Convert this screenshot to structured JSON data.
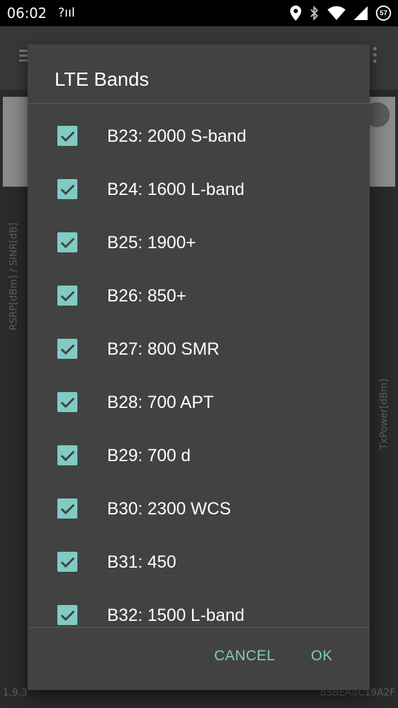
{
  "status_bar": {
    "time": "06:02",
    "signal_text": "?ııl",
    "battery": "57"
  },
  "background_app": {
    "chart_left_label": "RSRP[dBm] / SINR[dB]",
    "chart_right_label": "TxPower[dBm]",
    "bottom_left": "1,9,3",
    "bottom_right": "8SBEA8C19A2F"
  },
  "dialog": {
    "title": "LTE Bands",
    "items": [
      {
        "label": "B23: 2000 S-band",
        "checked": true
      },
      {
        "label": "B24: 1600 L-band",
        "checked": true
      },
      {
        "label": "B25: 1900+",
        "checked": true
      },
      {
        "label": "B26: 850+",
        "checked": true
      },
      {
        "label": "B27: 800 SMR",
        "checked": true
      },
      {
        "label": "B28: 700 APT",
        "checked": true
      },
      {
        "label": "B29: 700 d",
        "checked": true
      },
      {
        "label": "B30: 2300 WCS",
        "checked": true
      },
      {
        "label": "B31: 450",
        "checked": true
      },
      {
        "label": "B32: 1500 L-band",
        "checked": true
      }
    ],
    "cancel_label": "CANCEL",
    "ok_label": "OK"
  },
  "colors": {
    "accent": "#80cbc4",
    "dialog_bg": "#424242",
    "status_bar_bg": "#000000"
  }
}
